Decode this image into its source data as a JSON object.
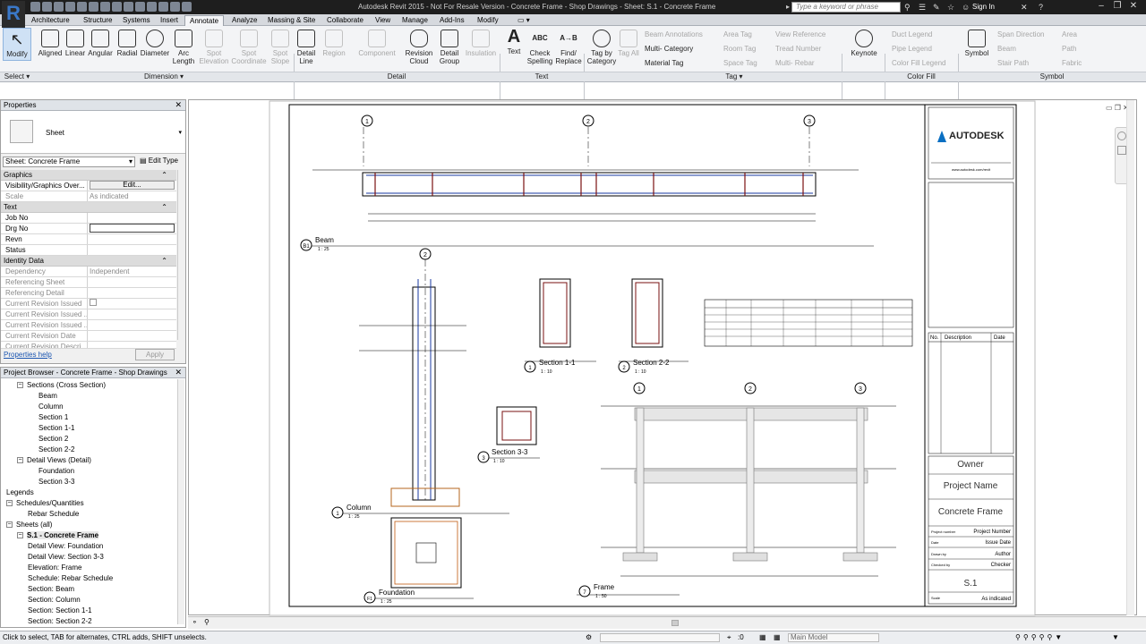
{
  "window": {
    "title": "Autodesk Revit 2015 -   Not For Resale Version  -   Concrete Frame - Shop Drawings - Sheet: S.1 - Concrete Frame",
    "search_placeholder": "Type a keyword or phrase",
    "signin": "Sign In"
  },
  "tabs": [
    "Architecture",
    "Structure",
    "Systems",
    "Insert",
    "Annotate",
    "Analyze",
    "Massing & Site",
    "Collaborate",
    "View",
    "Manage",
    "Add-Ins",
    "Modify"
  ],
  "active_tab": "Annotate",
  "ribbon": {
    "modify": "Modify",
    "dimension_tools": [
      "Aligned",
      "Linear",
      "Angular",
      "Radial",
      "Diameter",
      "Arc Length",
      "Spot Elevation",
      "Spot Coordinate",
      "Spot Slope"
    ],
    "detail_tools": [
      "Detail Line",
      "Region",
      "Component",
      "Revision Cloud",
      "Detail Group",
      "Insulation"
    ],
    "text_tools": [
      "Text",
      "Check Spelling",
      "Find/ Replace"
    ],
    "tag_tools": [
      "Tag by Category",
      "Tag All"
    ],
    "tag_small": [
      "Beam Annotations",
      "Multi- Category",
      "Material Tag",
      "Area Tag",
      "Room Tag",
      "Space Tag",
      "View Reference",
      "Tread Number",
      "Multi- Rebar"
    ],
    "keynote": "Keynote",
    "colorfill": [
      "Duct Legend",
      "Pipe Legend",
      "Color Fill Legend"
    ],
    "symbol_tools": [
      "Symbol",
      "Span Direction",
      "Beam",
      "Stair Path",
      "Area",
      "Path",
      "Fabric"
    ],
    "panels": [
      "Select",
      "Dimension",
      "Detail",
      "Text",
      "Tag",
      "Color Fill",
      "Symbol"
    ]
  },
  "properties": {
    "header": "Properties",
    "type": "Sheet",
    "selector": "Sheet: Concrete Frame",
    "edit_type": "Edit Type",
    "sections": {
      "graphics": "Graphics",
      "text": "Text",
      "identity": "Identity Data"
    },
    "rows_graphics": [
      {
        "k": "Visibility/Graphics Over...",
        "v": "Edit..."
      },
      {
        "k": "Scale",
        "v": "As indicated"
      }
    ],
    "rows_text": [
      {
        "k": "Job No",
        "v": ""
      },
      {
        "k": "Drg No",
        "v": ""
      },
      {
        "k": "Revn",
        "v": ""
      },
      {
        "k": "Status",
        "v": ""
      }
    ],
    "rows_identity": [
      {
        "k": "Dependency",
        "v": "Independent"
      },
      {
        "k": "Referencing Sheet",
        "v": ""
      },
      {
        "k": "Referencing Detail",
        "v": ""
      },
      {
        "k": "Current Revision Issued",
        "v": ""
      },
      {
        "k": "Current Revision Issued ...",
        "v": ""
      },
      {
        "k": "Current Revision Issued ...",
        "v": ""
      },
      {
        "k": "Current Revision Date",
        "v": ""
      },
      {
        "k": "Current Revision Descri...",
        "v": ""
      }
    ],
    "help": "Properties help",
    "apply": "Apply"
  },
  "browser": {
    "header": "Project Browser - Concrete Frame - Shop Drawings",
    "items": [
      {
        "label": "Sections (Cross Section)",
        "level": 1,
        "toggle": "-"
      },
      {
        "label": "Beam",
        "level": 3
      },
      {
        "label": "Column",
        "level": 3
      },
      {
        "label": "Section 1",
        "level": 3
      },
      {
        "label": "Section 1-1",
        "level": 3
      },
      {
        "label": "Section 2",
        "level": 3
      },
      {
        "label": "Section 2-2",
        "level": 3
      },
      {
        "label": "Detail Views (Detail)",
        "level": 1,
        "toggle": "-"
      },
      {
        "label": "Foundation",
        "level": 3
      },
      {
        "label": "Section 3-3",
        "level": 3
      },
      {
        "label": "Legends",
        "level": 0
      },
      {
        "label": "Schedules/Quantities",
        "level": 0,
        "toggle": "-"
      },
      {
        "label": "Rebar Schedule",
        "level": 2
      },
      {
        "label": "Sheets (all)",
        "level": 0,
        "toggle": "-"
      },
      {
        "label": "S.1 - Concrete Frame",
        "level": 1,
        "toggle": "-",
        "bold": true
      },
      {
        "label": "Detail View: Foundation",
        "level": 2
      },
      {
        "label": "Detail View: Section 3-3",
        "level": 2
      },
      {
        "label": "Elevation: Frame",
        "level": 2
      },
      {
        "label": "Schedule: Rebar Schedule",
        "level": 2
      },
      {
        "label": "Section: Beam",
        "level": 2
      },
      {
        "label": "Section: Column",
        "level": 2
      },
      {
        "label": "Section: Section 1-1",
        "level": 2
      },
      {
        "label": "Section: Section 2-2",
        "level": 2
      }
    ]
  },
  "sheet": {
    "brand": "AUTODESK",
    "brand_url": "www.autodesk.com/revit",
    "rev_headers": [
      "No.",
      "Description",
      "Date"
    ],
    "owner": "Owner",
    "project_name": "Project Name",
    "sheet_title": "Concrete Frame",
    "project_number_label": "Project number",
    "project_number": "Project Number",
    "date_label": "Date",
    "date": "Issue Date",
    "drawn_label": "Drawn by",
    "drawn": "Author",
    "checked_label": "Checked by",
    "checked": "Checker",
    "sheet_no": "S.1",
    "scale_label": "Scale",
    "scale": "As indicated",
    "views": [
      {
        "num": "B1",
        "name": "Beam",
        "scale": "1 : 25"
      },
      {
        "num": "1",
        "name": "Column",
        "scale": "1 : 25"
      },
      {
        "num": "1",
        "name": "Section 1-1",
        "scale": "1 : 10"
      },
      {
        "num": "2",
        "name": "Section 2-2",
        "scale": "1 : 10"
      },
      {
        "num": "3",
        "name": "Section 3-3",
        "scale": "1 : 10"
      },
      {
        "num": "F1",
        "name": "Foundation",
        "scale": "1 : 25"
      },
      {
        "num": "7",
        "name": "Frame",
        "scale": "1 : 50"
      }
    ],
    "grids": [
      "1",
      "2",
      "3"
    ],
    "column_grid": "2"
  },
  "status": {
    "hint": "Click to select, TAB for alternates, CTRL adds, SHIFT unselects.",
    "coord": ":0",
    "model": "Main Model"
  }
}
